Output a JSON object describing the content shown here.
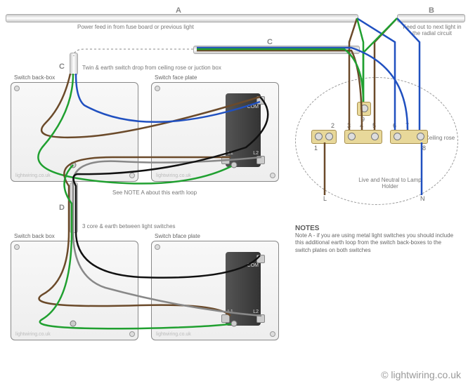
{
  "cables": {
    "A": {
      "letter": "A",
      "label": "Power feed in from fuse board or previous light"
    },
    "B": {
      "letter": "B",
      "label": "Feed out to next light in the radial circuit"
    },
    "C": {
      "letter": "C",
      "label": "Twin & earth switch drop from ceiling rose or juction box"
    },
    "D": {
      "letter": "D",
      "label": "3 core & earth between light switches"
    }
  },
  "boxes": {
    "sw1_back": "Switch back-box",
    "sw1_face": "Switch face plate",
    "sw2_back": "Switch back box",
    "sw2_face": "Switch bface plate"
  },
  "face_terms": {
    "com": "COM",
    "l1": "L1",
    "l2": "L2"
  },
  "rose": {
    "label": "Ceiling rose",
    "lamp": "Live and Neutral to Lamp Holder",
    "L": "L",
    "N": "N",
    "n1": "1",
    "n2": "2",
    "n3": "3",
    "n4": "4",
    "n5": "5",
    "n6": "6",
    "n7": "7",
    "n8": "8",
    "n9": "9"
  },
  "notes": {
    "earth": "See NOTE A about this earth loop",
    "heading": "NOTES",
    "noteA": "Note A - if you are using metal light switches you should include this additional earth loop from the switch back-boxes to the switch plates on both switches"
  },
  "watermark": "lightwiring.co.uk",
  "copyright": "© lightwiring.co.uk",
  "colors": {
    "live": "#6b4a2a",
    "neutral": "#2050c0",
    "earth": "#20a030",
    "brown": "#6b4a2a",
    "black": "#111",
    "grey": "#888"
  }
}
